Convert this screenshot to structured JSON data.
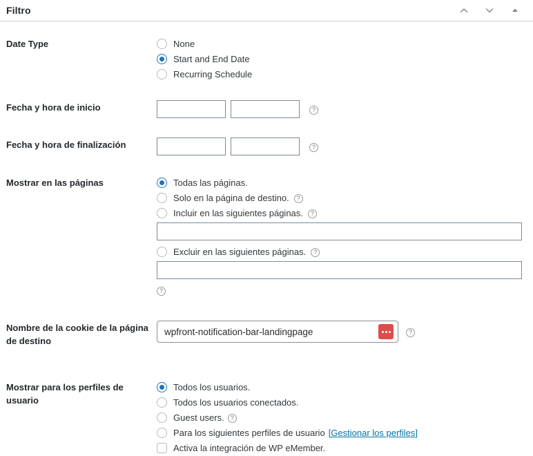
{
  "header": {
    "title": "Filtro",
    "actions": [
      {
        "name": "move-up-icon",
        "label": "Subir"
      },
      {
        "name": "move-down-icon",
        "label": "Bajar"
      },
      {
        "name": "collapse-toggle-icon",
        "label": "Contraer"
      }
    ]
  },
  "help_glyph": "?",
  "rows": {
    "date_type": {
      "label": "Date Type",
      "options": [
        {
          "label": "None",
          "selected": false
        },
        {
          "label": "Start and End Date",
          "selected": true
        },
        {
          "label": "Recurring Schedule",
          "selected": false
        }
      ]
    },
    "start_date": {
      "label": "Fecha y hora de inicio",
      "date_value": "",
      "date_placeholder": "",
      "time_value": "",
      "time_placeholder": ""
    },
    "end_date": {
      "label": "Fecha y hora de finalización",
      "date_value": "",
      "date_placeholder": "",
      "time_value": "",
      "time_placeholder": ""
    },
    "show_pages": {
      "label": "Mostrar en las páginas",
      "options": [
        {
          "label": "Todas las páginas.",
          "selected": true,
          "help": false
        },
        {
          "label": "Solo en la página de destino.",
          "selected": false,
          "help": true
        },
        {
          "label": "Incluir en las siguientes páginas.",
          "selected": false,
          "help": true
        },
        {
          "label": "Excluir en las siguientes páginas.",
          "selected": false,
          "help": true
        }
      ],
      "include_value": "",
      "include_placeholder": "",
      "exclude_value": "",
      "exclude_placeholder": ""
    },
    "cookie": {
      "label": "Nombre de la cookie de la página de destino",
      "value": "wpfront-notification-bar-landingpage",
      "placeholder": "",
      "button_name": "ellipsis-button"
    },
    "user_roles": {
      "label": "Mostrar para los perfiles de usuario",
      "options": [
        {
          "label": "Todos los usuarios.",
          "selected": true,
          "help": false
        },
        {
          "label": "Todos los usuarios conectados.",
          "selected": false,
          "help": false
        },
        {
          "label": "Guest users.",
          "selected": false,
          "help": true
        }
      ],
      "roles_option": {
        "label": "Para los siguientes perfiles de usuario",
        "link": "[Gestionar los perfiles]",
        "selected": false
      },
      "emember_option": {
        "label": "Activa la integración de WP eMember.",
        "checked": false
      }
    }
  },
  "colors": {
    "accent": "#1e73be",
    "link": "#0073aa",
    "danger": "#e04b4b",
    "border": "#7e8993"
  }
}
